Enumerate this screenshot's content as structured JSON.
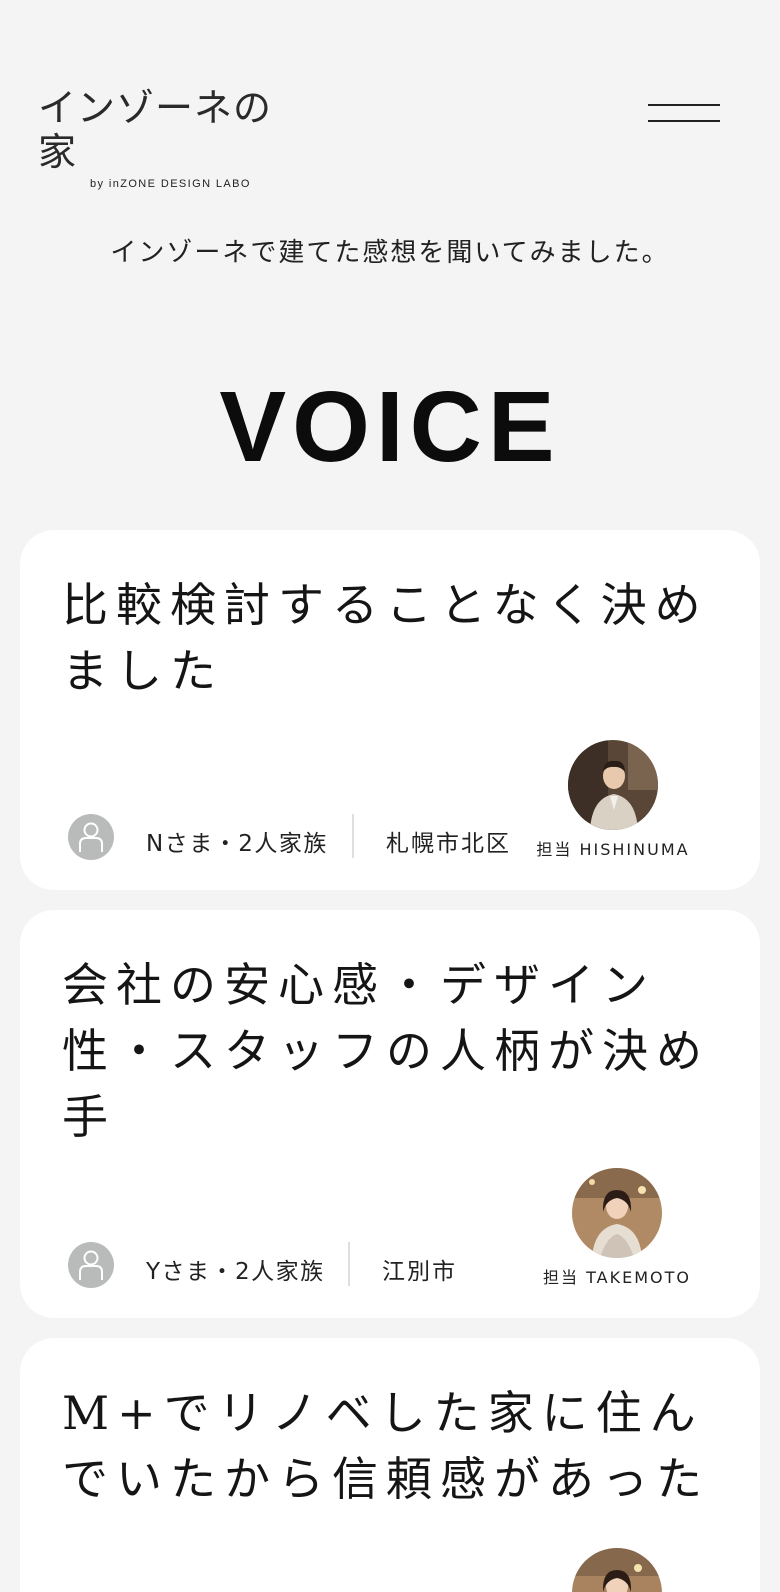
{
  "header": {
    "logo_main": "インゾーネの家",
    "logo_sub": "by inZONE DESIGN LABO",
    "menu_icon": "hamburger-menu-icon"
  },
  "intro": {
    "lead": "インゾーネで建てた感想を聞いてみました。",
    "title": "VOICE"
  },
  "voices": [
    {
      "title": "比較検討することなく決めました",
      "customer": "Nさま・2人家族",
      "location": "札幌市北区",
      "staff_label": "担当 HISHINUMA",
      "customer_icon": "person-placeholder-icon"
    },
    {
      "title": "会社の安心感・デザイン性・スタッフの人柄が決め手",
      "customer": "Yさま・2人家族",
      "location": "江別市",
      "staff_label": "担当 TAKEMOTO",
      "customer_icon": "person-placeholder-icon"
    },
    {
      "title": "M+でリノベした家に住んでいたから信頼感があった"
    }
  ],
  "colors": {
    "background": "#f4f4f4",
    "card": "#ffffff",
    "avatar_gray": "#b9bbba",
    "text": "#111111"
  }
}
